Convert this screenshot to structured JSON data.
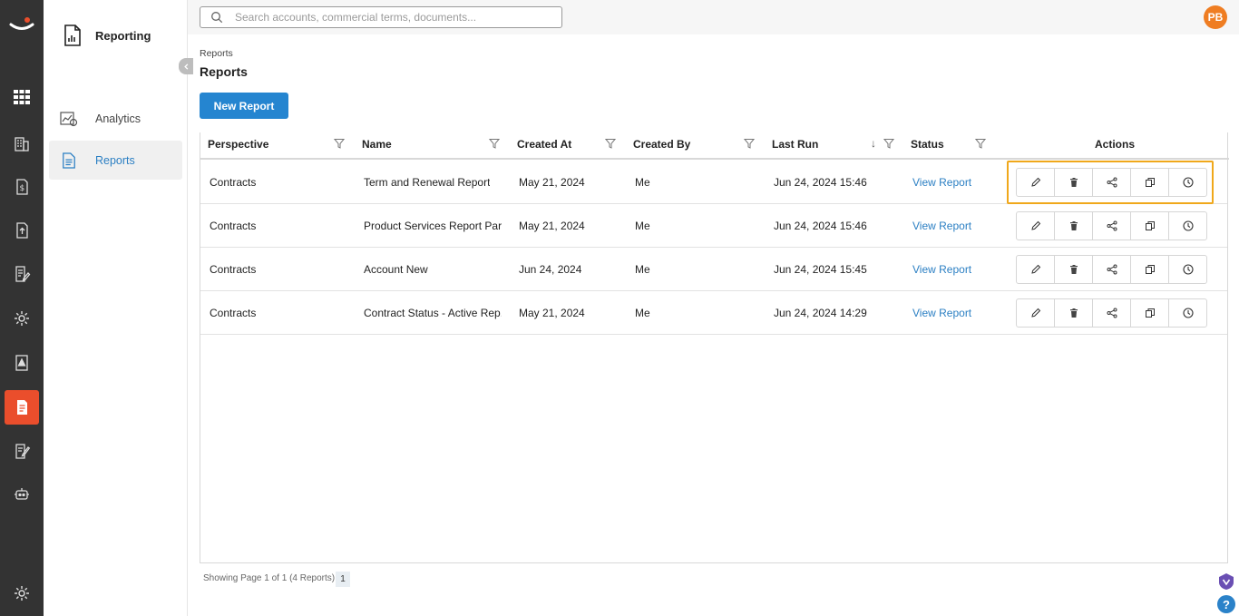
{
  "nav_rail": {
    "items": [
      {
        "icon": "apps-grid-icon"
      },
      {
        "icon": "building-icon"
      },
      {
        "icon": "money-document-icon"
      },
      {
        "icon": "upload-document-icon"
      },
      {
        "icon": "edit-document-icon"
      },
      {
        "icon": "settings-gear-icon"
      },
      {
        "icon": "warning-document-icon"
      },
      {
        "icon": "report-document-icon"
      },
      {
        "icon": "signature-document-icon"
      },
      {
        "icon": "robot-icon"
      },
      {
        "icon": "gear-icon"
      }
    ],
    "active_color": "#ea4e2c"
  },
  "sidebar": {
    "title": "Reporting",
    "items": [
      {
        "label": "Analytics",
        "icon": "analytics-icon"
      },
      {
        "label": "Reports",
        "icon": "reports-icon"
      }
    ]
  },
  "search": {
    "placeholder": "Search accounts, commercial terms, documents..."
  },
  "user": {
    "initials": "PB",
    "color": "#ef7d22"
  },
  "breadcrumb": "Reports",
  "page_title": "Reports",
  "new_report_label": "New Report",
  "table": {
    "columns": [
      "Perspective",
      "Name",
      "Created At",
      "Created By",
      "Last Run",
      "Status",
      "Actions"
    ],
    "sort_indicator": "↓",
    "rows": [
      {
        "perspective": "Contracts",
        "name": "Term and Renewal Report",
        "created_at": "May 21, 2024",
        "created_by": "Me",
        "last_run": "Jun 24, 2024 15:46",
        "status": "View Report"
      },
      {
        "perspective": "Contracts",
        "name": "Product Services Report Part B",
        "created_at": "May 21, 2024",
        "created_by": "Me",
        "last_run": "Jun 24, 2024 15:46",
        "status": "View Report"
      },
      {
        "perspective": "Contracts",
        "name": "Account New",
        "created_at": "Jun 24, 2024",
        "created_by": "Me",
        "last_run": "Jun 24, 2024 15:45",
        "status": "View Report"
      },
      {
        "perspective": "Contracts",
        "name": "Contract Status - Active Rep...",
        "created_at": "May 21, 2024",
        "created_by": "Me",
        "last_run": "Jun 24, 2024 14:29",
        "status": "View Report"
      }
    ],
    "action_icons": [
      "edit-icon",
      "delete-icon",
      "share-icon",
      "copy-icon",
      "schedule-icon"
    ]
  },
  "pager": {
    "summary": "Showing Page 1 of 1 (4 Reports)",
    "current_page": "1"
  },
  "help_label": "?",
  "colors": {
    "primary": "#2585d0",
    "link": "#2b7fc3",
    "highlight": "#f0a81b"
  }
}
